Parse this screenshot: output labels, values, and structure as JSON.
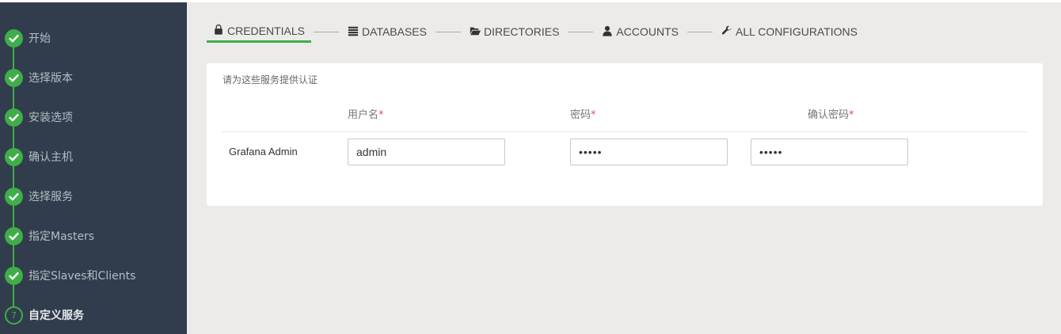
{
  "sidebar": {
    "steps": [
      {
        "label": "开始"
      },
      {
        "label": "选择版本"
      },
      {
        "label": "安装选项"
      },
      {
        "label": "确认主机"
      },
      {
        "label": "选择服务"
      },
      {
        "label": "指定Masters"
      },
      {
        "label": "指定Slaves和Clients"
      },
      {
        "label": "自定义服务",
        "number": "7"
      }
    ]
  },
  "tabs": [
    {
      "label": "CREDENTIALS",
      "icon": "lock-icon"
    },
    {
      "label": "DATABASES",
      "icon": "list-icon"
    },
    {
      "label": "DIRECTORIES",
      "icon": "folder-open-icon"
    },
    {
      "label": "ACCOUNTS",
      "icon": "user-icon"
    },
    {
      "label": "ALL CONFIGURATIONS",
      "icon": "wrench-icon"
    }
  ],
  "credentials": {
    "hint": "请为这些服务提供认证",
    "columns": {
      "username": "用户名",
      "password": "密码",
      "confirm": "确认密码",
      "required_mark": "*"
    },
    "row": {
      "label": "Grafana Admin",
      "username_value": "admin",
      "password_value": "admin",
      "confirm_value": "admin"
    }
  },
  "colors": {
    "accent": "#3fae49",
    "sidebar_bg": "#313d4d",
    "required": "#d9534f"
  }
}
